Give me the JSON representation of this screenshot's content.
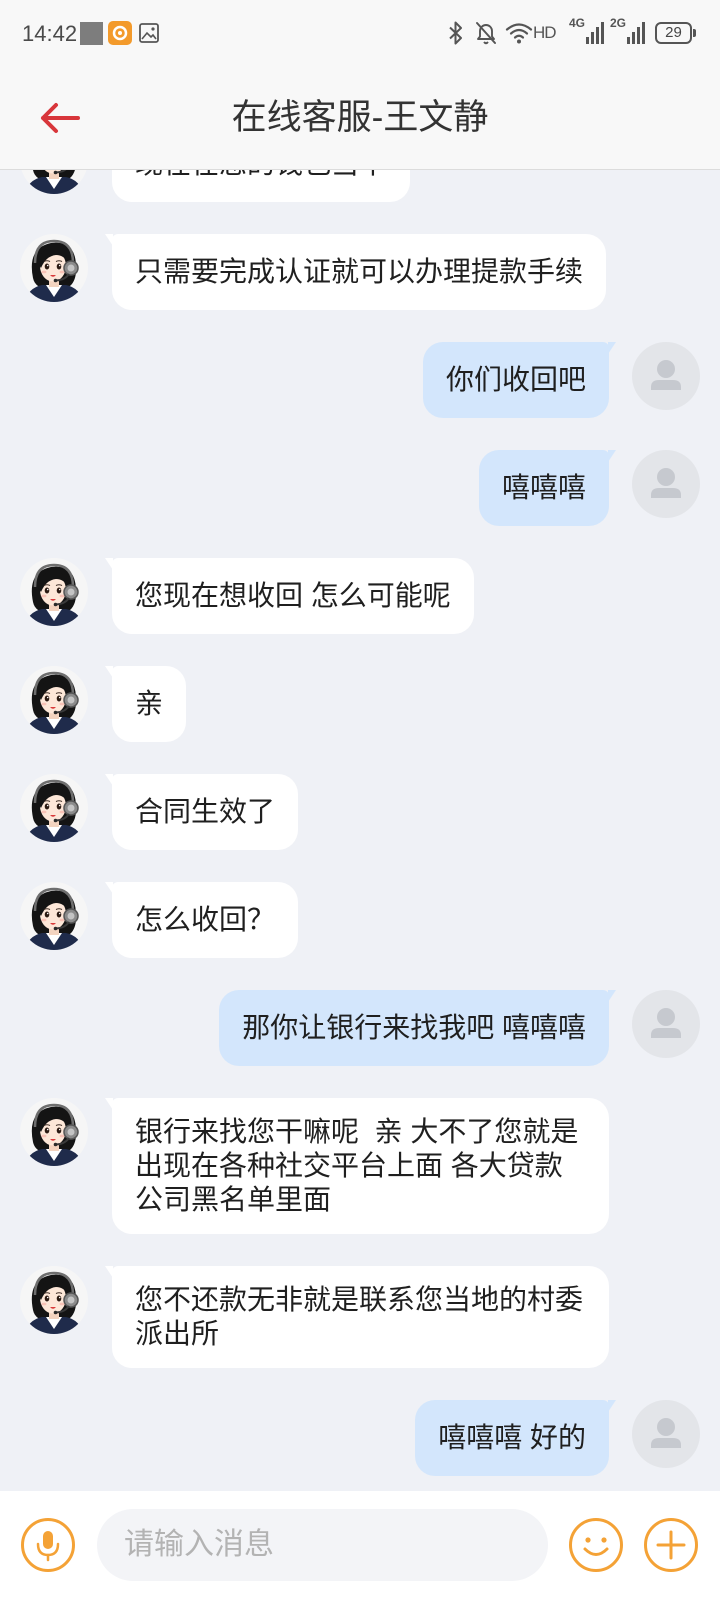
{
  "status_bar": {
    "time": "14:42",
    "hd_label": "HD",
    "network_1": "4G",
    "network_2": "2G",
    "battery_level": "29",
    "left_icons": [
      "notification-square-icon",
      "app-notification-icon",
      "gallery-icon"
    ],
    "right_icons": [
      "bluetooth-icon",
      "bell-off-icon",
      "wifi-icon",
      "signal-icon",
      "battery-icon"
    ]
  },
  "header": {
    "title": "在线客服-王文静",
    "back_icon": "arrow-left-icon"
  },
  "messages": [
    {
      "avatar": "agent-avatar-icon",
      "lines": [
        "现在在您的钱包当中"
      ]
    },
    {
      "avatar": "agent-avatar-icon",
      "lines": [
        "只需要完成认证就可以办理提款手续"
      ]
    },
    {
      "avatar": "user-avatar-icon",
      "lines": [
        "你们收回吧"
      ]
    },
    {
      "avatar": "user-avatar-icon",
      "lines": [
        "嘻嘻嘻"
      ]
    },
    {
      "avatar": "agent-avatar-icon",
      "lines": [
        "您现在想收回 怎么可能呢"
      ]
    },
    {
      "avatar": "agent-avatar-icon",
      "lines": [
        "亲"
      ]
    },
    {
      "avatar": "agent-avatar-icon",
      "lines": [
        "合同生效了"
      ]
    },
    {
      "avatar": "agent-avatar-icon",
      "lines": [
        "怎么收回？"
      ]
    },
    {
      "avatar": "user-avatar-icon",
      "lines": [
        "那你让银行来找我吧 嘻嘻嘻"
      ]
    },
    {
      "avatar": "agent-avatar-icon",
      "lines": [
        "银行来找您干嘛呢  亲 大不了您就是",
        "出现在各种社交平台上面 各大贷款",
        "公司黑名单里面"
      ]
    },
    {
      "avatar": "agent-avatar-icon",
      "lines": [
        "您不还款无非就是联系您当地的村委",
        "派出所"
      ]
    },
    {
      "avatar": "user-avatar-icon",
      "lines": [
        "嘻嘻嘻 好的"
      ]
    }
  ],
  "input_bar": {
    "placeholder": "请输入消息",
    "voice_icon": "microphone-icon",
    "emoji_icon": "smiley-icon",
    "more_icon": "plus-icon"
  },
  "colors": {
    "accent": "#f4a236",
    "back_arrow": "#d8363b",
    "user_bubble": "#d3e6fc",
    "agent_bubble": "#ffffff",
    "chat_background": "#eff1f6",
    "header_background": "#f8f8f8",
    "input_background": "#f3f4f7"
  }
}
